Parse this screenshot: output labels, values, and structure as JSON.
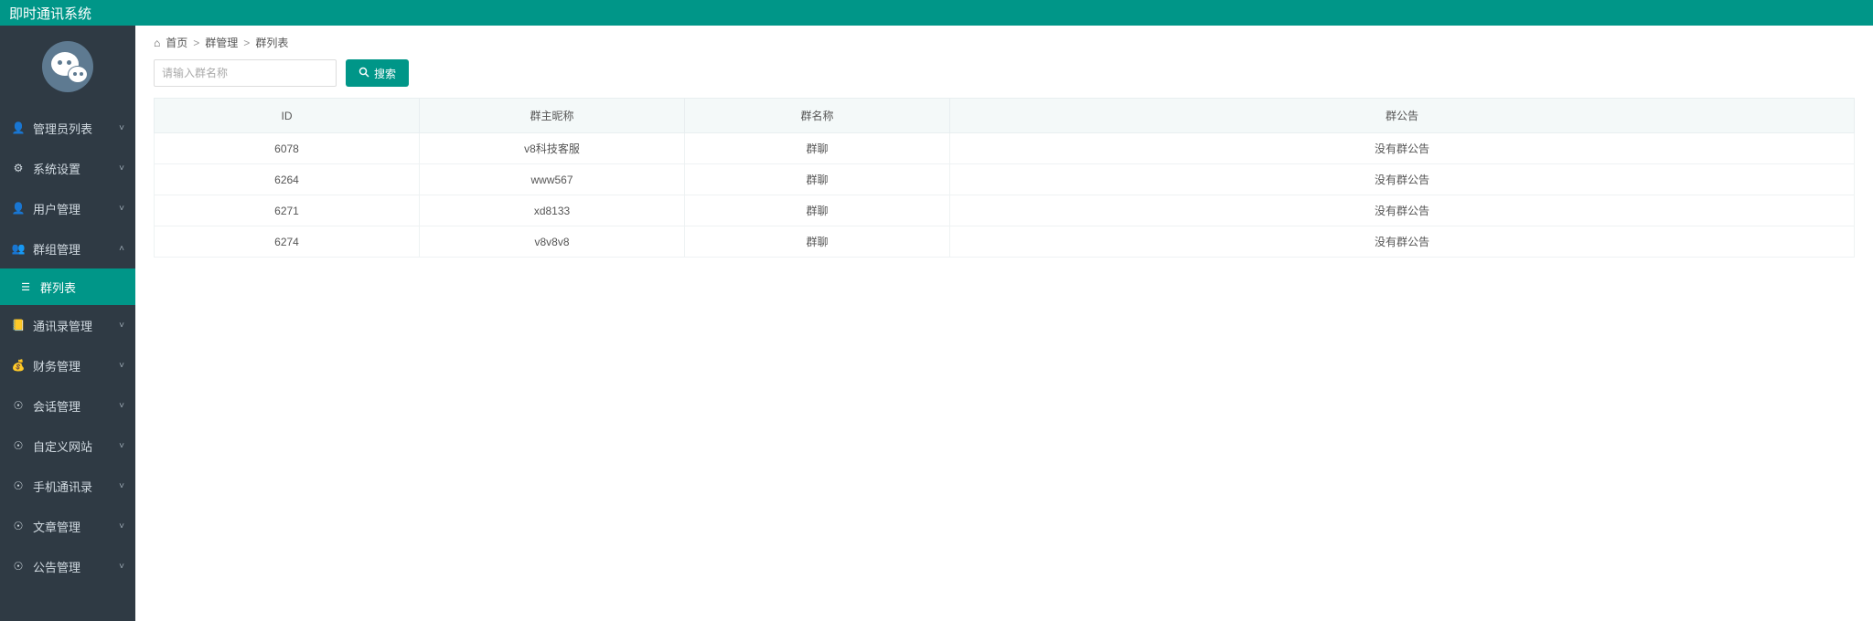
{
  "header": {
    "title": "即时通讯系统"
  },
  "sidebar": {
    "items": [
      {
        "icon": "person-icon",
        "glyph": "👤",
        "label": "管理员列表",
        "expanded": false
      },
      {
        "icon": "gear-icon",
        "glyph": "⚙",
        "label": "系统设置",
        "expanded": false
      },
      {
        "icon": "user-icon",
        "glyph": "👤",
        "label": "用户管理",
        "expanded": false
      },
      {
        "icon": "group-icon",
        "glyph": "👥",
        "label": "群组管理",
        "expanded": true
      },
      {
        "icon": "contacts-icon",
        "glyph": "📒",
        "label": "通讯录管理",
        "expanded": false
      },
      {
        "icon": "finance-icon",
        "glyph": "💰",
        "label": "财务管理",
        "expanded": false
      },
      {
        "icon": "chat-icon",
        "glyph": "☉",
        "label": "会话管理",
        "expanded": false
      },
      {
        "icon": "site-icon",
        "glyph": "☉",
        "label": "自定义网站",
        "expanded": false
      },
      {
        "icon": "phone-icon",
        "glyph": "☉",
        "label": "手机通讯录",
        "expanded": false
      },
      {
        "icon": "article-icon",
        "glyph": "☉",
        "label": "文章管理",
        "expanded": false
      },
      {
        "icon": "notice-icon",
        "glyph": "☉",
        "label": "公告管理",
        "expanded": false
      }
    ],
    "sub": {
      "icon": "list-icon",
      "glyph": "☰",
      "label": "群列表"
    }
  },
  "breadcrumb": {
    "home": "首页",
    "level1": "群管理",
    "level2": "群列表",
    "sep": ">"
  },
  "search": {
    "placeholder": "请输入群名称",
    "button": "搜索"
  },
  "table": {
    "headers": {
      "id": "ID",
      "owner": "群主昵称",
      "name": "群名称",
      "notice": "群公告"
    },
    "rows": [
      {
        "id": "6078",
        "owner": "v8科技客服",
        "name": "群聊",
        "notice": "没有群公告"
      },
      {
        "id": "6264",
        "owner": "www567",
        "name": "群聊",
        "notice": "没有群公告"
      },
      {
        "id": "6271",
        "owner": "xd8133",
        "name": "群聊",
        "notice": "没有群公告"
      },
      {
        "id": "6274",
        "owner": "v8v8v8",
        "name": "群聊",
        "notice": "没有群公告"
      }
    ]
  }
}
